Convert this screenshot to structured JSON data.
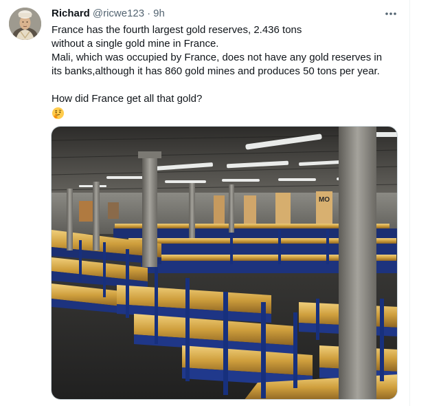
{
  "tweet": {
    "display_name": "Richard",
    "handle": "@ricwe123",
    "separator": "·",
    "time": "9h",
    "text_lines": [
      "France has the fourth largest gold reserves, 2.436 tons",
      "without a single gold mine in France.",
      "Mali, which was occupied by France, does not have any gold reserves in",
      "its banks,although it has 860 gold mines and produces 50 tons per year.",
      "",
      "How did France get all that gold?"
    ],
    "emoji": "thinking-face",
    "more_icon": "more-horizontal-icon"
  },
  "media": {
    "signs": [
      "MO"
    ]
  },
  "colors": {
    "text_primary": "#0f1419",
    "text_secondary": "#536471",
    "gold": "#d4a640",
    "rack_blue": "#1f3a8c"
  }
}
